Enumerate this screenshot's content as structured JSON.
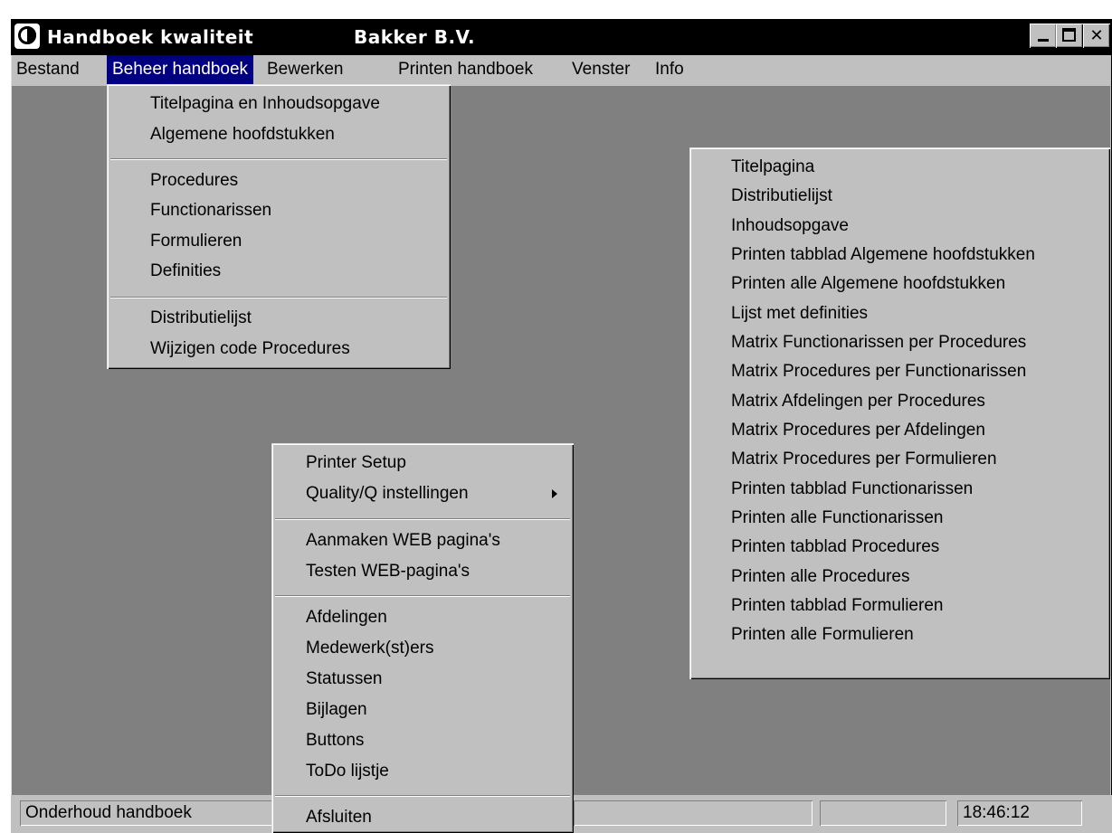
{
  "window": {
    "title": "Handboek kwaliteit",
    "company": "Bakker B.V.",
    "buttons": {
      "minimize": "minimize",
      "maximize": "maximize",
      "close": "✕"
    }
  },
  "menubar": [
    "Bestand",
    "Beheer handboek",
    "Bewerken",
    "Printen handboek",
    "Venster",
    "Info"
  ],
  "beheer_menu": {
    "groups": [
      [
        "Titelpagina en Inhoudsopgave",
        "Algemene hoofdstukken"
      ],
      [
        "Procedures",
        "Functionarissen",
        "Formulieren",
        "Definities"
      ],
      [
        "Distributielijst",
        "Wijzigen code Procedures"
      ]
    ]
  },
  "printen_menu": {
    "items": [
      "Titelpagina",
      "Distributielijst",
      "Inhoudsopgave",
      "Printen tabblad Algemene hoofdstukken",
      "Printen alle Algemene hoofdstukken",
      "Lijst met definities",
      "Matrix Functionarissen per Procedures",
      "Matrix Procedures per Functionarissen",
      "Matrix Afdelingen per Procedures",
      "Matrix Procedures per Afdelingen",
      "Matrix Procedures per Formulieren",
      "Printen tabblad Functionarissen",
      "Printen alle Functionarissen",
      "Printen tabblad Procedures",
      "Printen alle Procedures",
      "Printen tabblad Formulieren",
      "Printen alle Formulieren"
    ]
  },
  "bestand_menu": {
    "groups": [
      [
        "Printer Setup",
        "Quality/Q instellingen"
      ],
      [
        "Aanmaken WEB pagina's",
        "Testen WEB-pagina's"
      ],
      [
        "Afdelingen",
        "Medewerk(st)ers",
        "Statussen",
        "Bijlagen",
        "Buttons",
        "ToDo lijstje"
      ],
      [
        "Afsluiten"
      ]
    ],
    "submenu_item": "Quality/Q instellingen"
  },
  "statusbar": {
    "message": "Onderhoud handboek",
    "time": "18:46:12"
  },
  "icons": {
    "app": "app-logo-icon",
    "submenu": "submenu-arrow-icon"
  }
}
